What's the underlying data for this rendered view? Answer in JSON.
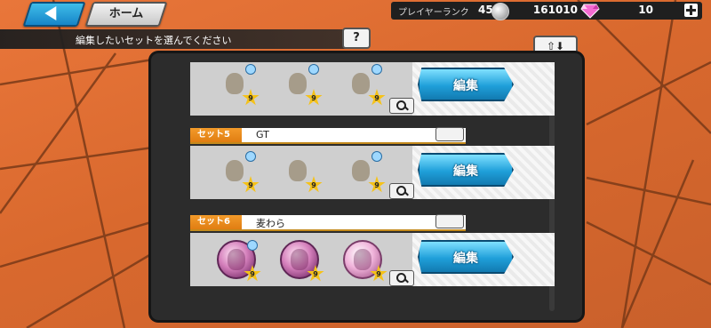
{
  "header": {
    "back_label": "",
    "home_label": "ホーム",
    "player_rank_label": "プレイヤーランク",
    "player_rank_value": "45",
    "coins": "161010",
    "gems": "10"
  },
  "instruction": {
    "text": "編集したいセットを選んでください",
    "help_label": "?",
    "sort_label": "⇧⬇"
  },
  "sets": [
    {
      "tag": "",
      "name": "",
      "medals": [
        {
          "style": "gold",
          "level": "9"
        },
        {
          "style": "gold",
          "level": "9"
        },
        {
          "style": "gold",
          "level": "9"
        }
      ],
      "edit_label": "編集"
    },
    {
      "tag": "セット5",
      "name": "GT",
      "medals": [
        {
          "style": "gold",
          "level": "9"
        },
        {
          "style": "gold",
          "level": "9"
        },
        {
          "style": "gold",
          "level": "9"
        }
      ],
      "edit_label": "編集"
    },
    {
      "tag": "セット6",
      "name": "麦わら",
      "medals": [
        {
          "style": "pink",
          "level": "9"
        },
        {
          "style": "pink",
          "level": "9"
        },
        {
          "style": "pinklight",
          "level": "9"
        }
      ],
      "edit_label": "編集"
    }
  ],
  "colors": {
    "accent_orange": "#e07d12",
    "edit_blue": "#1f9fd9",
    "panel_dark": "#2c2c2c"
  }
}
